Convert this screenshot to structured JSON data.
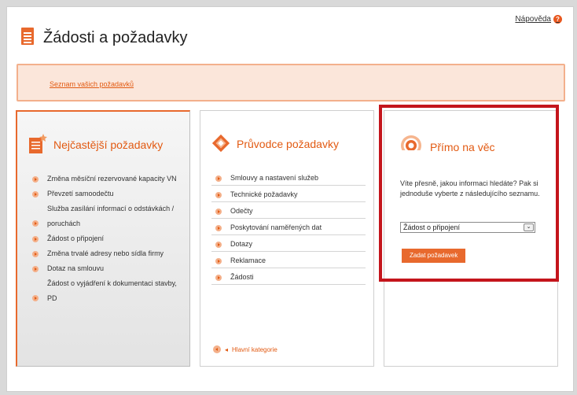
{
  "header": {
    "help_label": "Nápověda",
    "help_icon": "?",
    "title": "Žádosti a požadavky"
  },
  "banner": {
    "link_label": "Seznam vašich požadavků"
  },
  "frequent": {
    "heading": "Nejčastější požadavky",
    "items": [
      "Změna měsíční rezervované kapacity VN",
      "Převzetí samoodečtu",
      "Služba zasílání informací o odstávkách / poruchách",
      "Žádost o připojení",
      "Změna trvalé adresy nebo sídla firmy",
      "Dotaz na smlouvu",
      "Žádost o vyjádření k dokumentaci stavby, PD"
    ]
  },
  "guide": {
    "heading": "Průvodce požadavky",
    "items": [
      "Smlouvy a nastavení služeb",
      "Technické požadavky",
      "Odečty",
      "Poskytování naměřených dat",
      "Dotazy",
      "Reklamace",
      "Žádosti"
    ],
    "back_link": "Hlavní kategorie"
  },
  "direct": {
    "heading": "Přímo na věc",
    "description": "Víte přesně, jakou informaci hledáte? Pak si jednoduše vyberte z následujícího seznamu.",
    "selected_option": "Žádost o připojení",
    "submit_label": "Zadat požadavek"
  },
  "colors": {
    "accent": "#e8692d",
    "link": "#e25a12",
    "highlight": "#c4151c"
  }
}
